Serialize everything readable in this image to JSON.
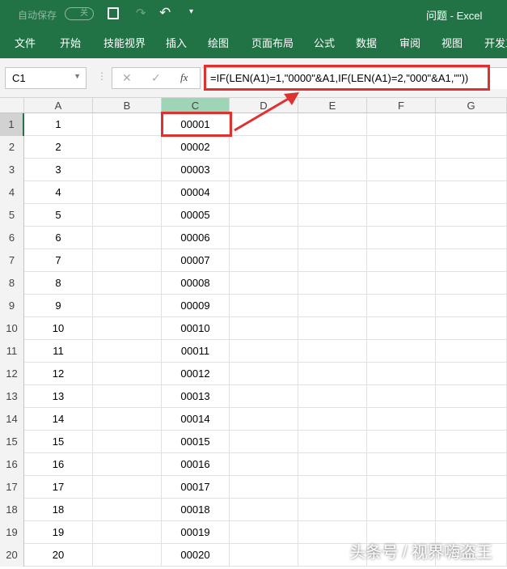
{
  "title": {
    "autosave_label": "自动保存",
    "autosave_state": "关",
    "doc": "问题",
    "separator": "-",
    "app": "Excel"
  },
  "ribbon": [
    "文件",
    "开始",
    "技能视界",
    "插入",
    "绘图",
    "页面布局",
    "公式",
    "数据",
    "审阅",
    "视图",
    "开发工"
  ],
  "formula_bar": {
    "name_box": "C1",
    "fx": "fx",
    "cancel": "✕",
    "enter": "✓",
    "formula": "=IF(LEN(A1)=1,\"0000\"&A1,IF(LEN(A1)=2,\"000\"&A1,\"\"))"
  },
  "columns": [
    "A",
    "B",
    "C",
    "D",
    "E",
    "F",
    "G"
  ],
  "rows": [
    {
      "n": "1",
      "a": "1",
      "c": "00001"
    },
    {
      "n": "2",
      "a": "2",
      "c": "00002"
    },
    {
      "n": "3",
      "a": "3",
      "c": "00003"
    },
    {
      "n": "4",
      "a": "4",
      "c": "00004"
    },
    {
      "n": "5",
      "a": "5",
      "c": "00005"
    },
    {
      "n": "6",
      "a": "6",
      "c": "00006"
    },
    {
      "n": "7",
      "a": "7",
      "c": "00007"
    },
    {
      "n": "8",
      "a": "8",
      "c": "00008"
    },
    {
      "n": "9",
      "a": "9",
      "c": "00009"
    },
    {
      "n": "10",
      "a": "10",
      "c": "00010"
    },
    {
      "n": "11",
      "a": "11",
      "c": "00011"
    },
    {
      "n": "12",
      "a": "12",
      "c": "00012"
    },
    {
      "n": "13",
      "a": "13",
      "c": "00013"
    },
    {
      "n": "14",
      "a": "14",
      "c": "00014"
    },
    {
      "n": "15",
      "a": "15",
      "c": "00015"
    },
    {
      "n": "16",
      "a": "16",
      "c": "00016"
    },
    {
      "n": "17",
      "a": "17",
      "c": "00017"
    },
    {
      "n": "18",
      "a": "18",
      "c": "00018"
    },
    {
      "n": "19",
      "a": "19",
      "c": "00019"
    },
    {
      "n": "20",
      "a": "20",
      "c": "00020"
    }
  ],
  "watermark": "头条号 / 视界嗨盗王",
  "colors": {
    "brand": "#217346",
    "highlight": "#e03131",
    "selected_header": "#9fd5b7"
  }
}
